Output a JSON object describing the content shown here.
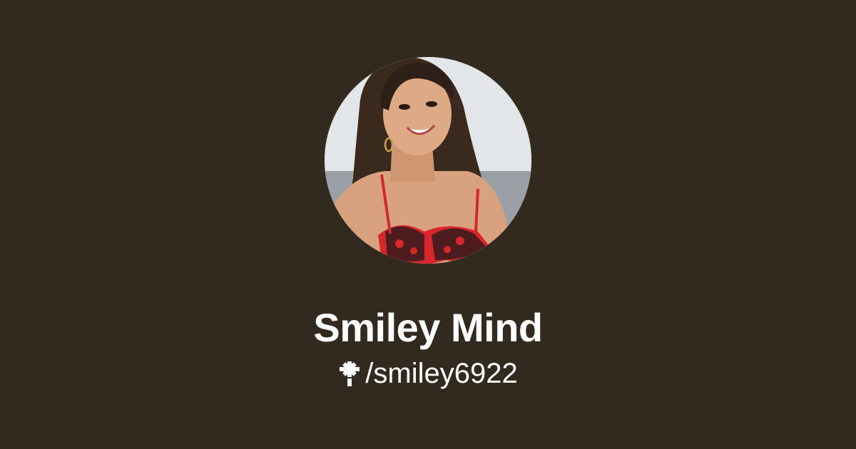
{
  "profile": {
    "display_name": "Smiley Mind",
    "handle": "/smiley6922",
    "avatar_icon": "profile-photo",
    "logo_icon": "linktree-asterisk-icon"
  },
  "colors": {
    "background": "#332a1f",
    "text": "#ffffff"
  }
}
